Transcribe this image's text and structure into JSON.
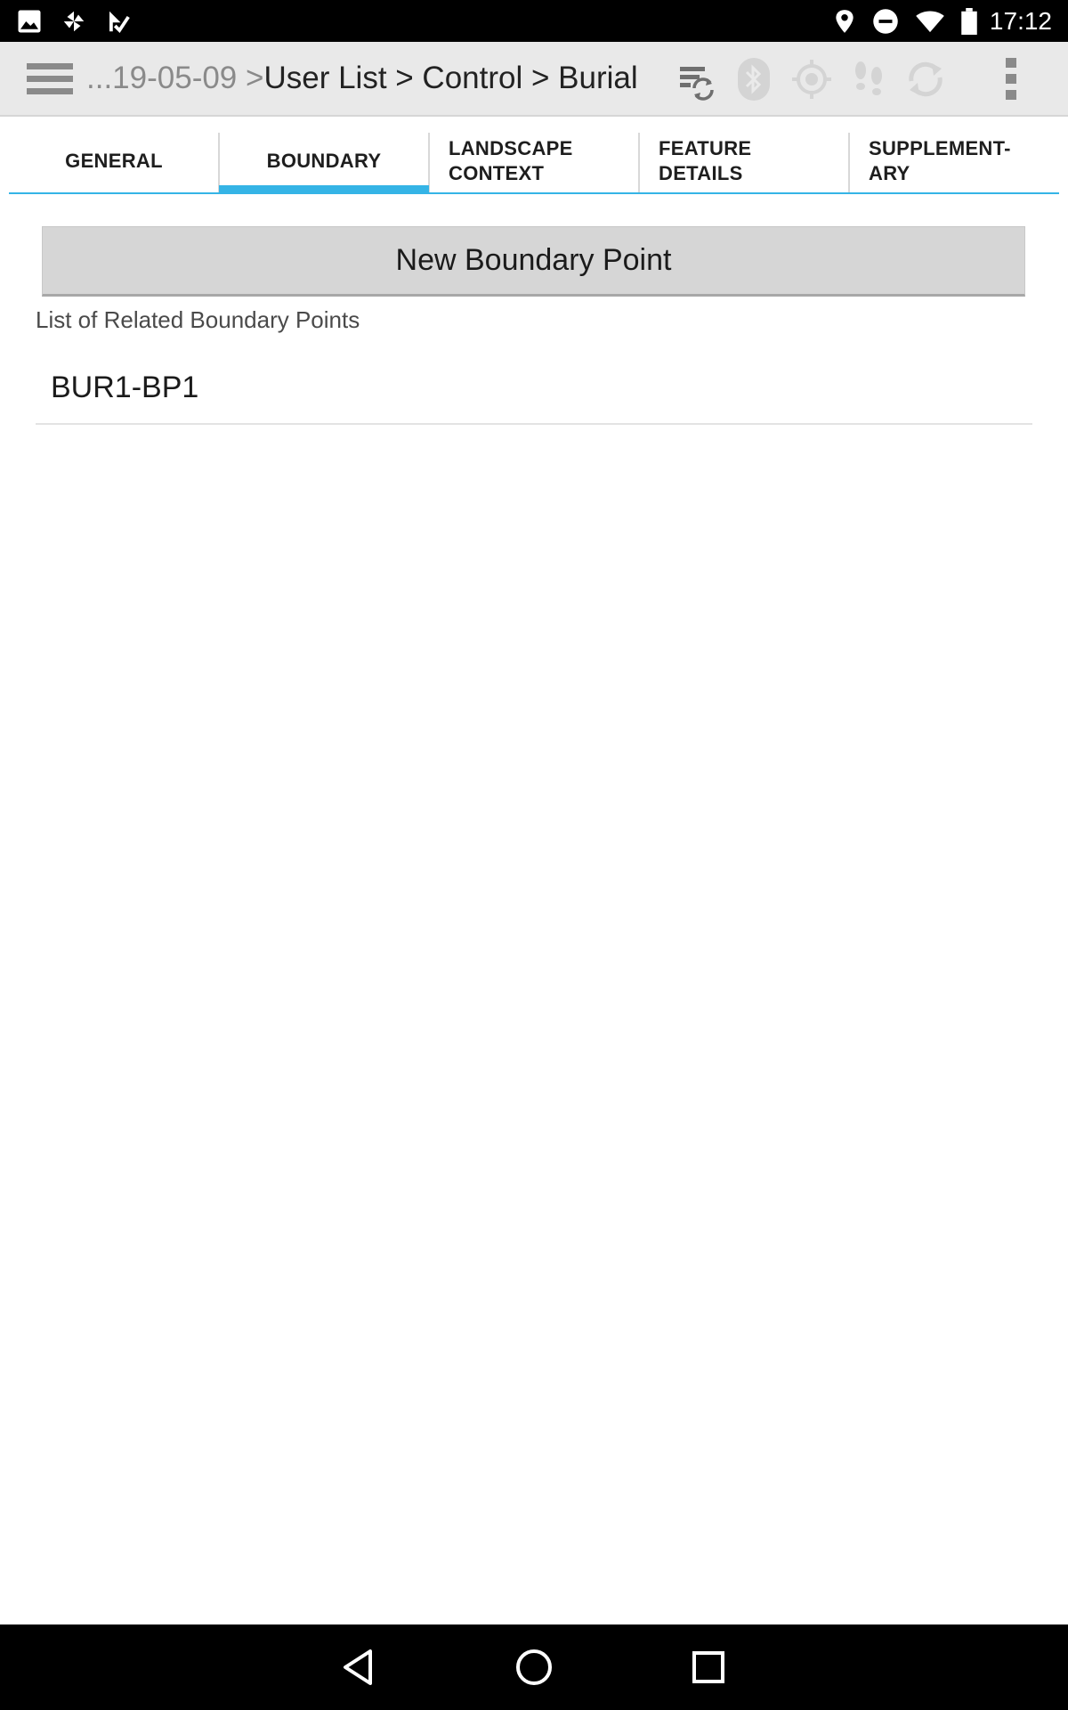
{
  "status_bar": {
    "time": "17:12",
    "icons": [
      "image-icon",
      "pinwheel-icon",
      "check-flag-icon",
      "location-icon",
      "do-not-disturb-icon",
      "wifi-icon",
      "battery-icon"
    ]
  },
  "action_bar": {
    "breadcrumb_prefix": "...19-05-09 > ",
    "breadcrumb_path": "User List > Control > Burial",
    "icons": [
      "menu-icon",
      "sync-records-icon",
      "bluetooth-icon",
      "gps-icon",
      "tracking-icon",
      "refresh-icon",
      "overflow-menu-icon"
    ]
  },
  "tabs": [
    {
      "label": "GENERAL",
      "active": false
    },
    {
      "label": "BOUNDARY",
      "active": true
    },
    {
      "label": "LANDSCAPE\nCONTEXT",
      "active": false
    },
    {
      "label": "FEATURE\nDETAILS",
      "active": false
    },
    {
      "label": "SUPPLEMENT-\nARY",
      "active": false
    }
  ],
  "content": {
    "new_button_label": "New Boundary Point",
    "list_header": "List of Related Boundary Points",
    "items": [
      {
        "label": "BUR1-BP1"
      }
    ]
  },
  "nav_bar": {
    "icons": [
      "back-icon",
      "home-icon",
      "recents-icon"
    ]
  },
  "colors": {
    "accent": "#35b4e6",
    "action_bar_bg": "#e9e9e9",
    "button_bg": "#d6d6d6"
  }
}
